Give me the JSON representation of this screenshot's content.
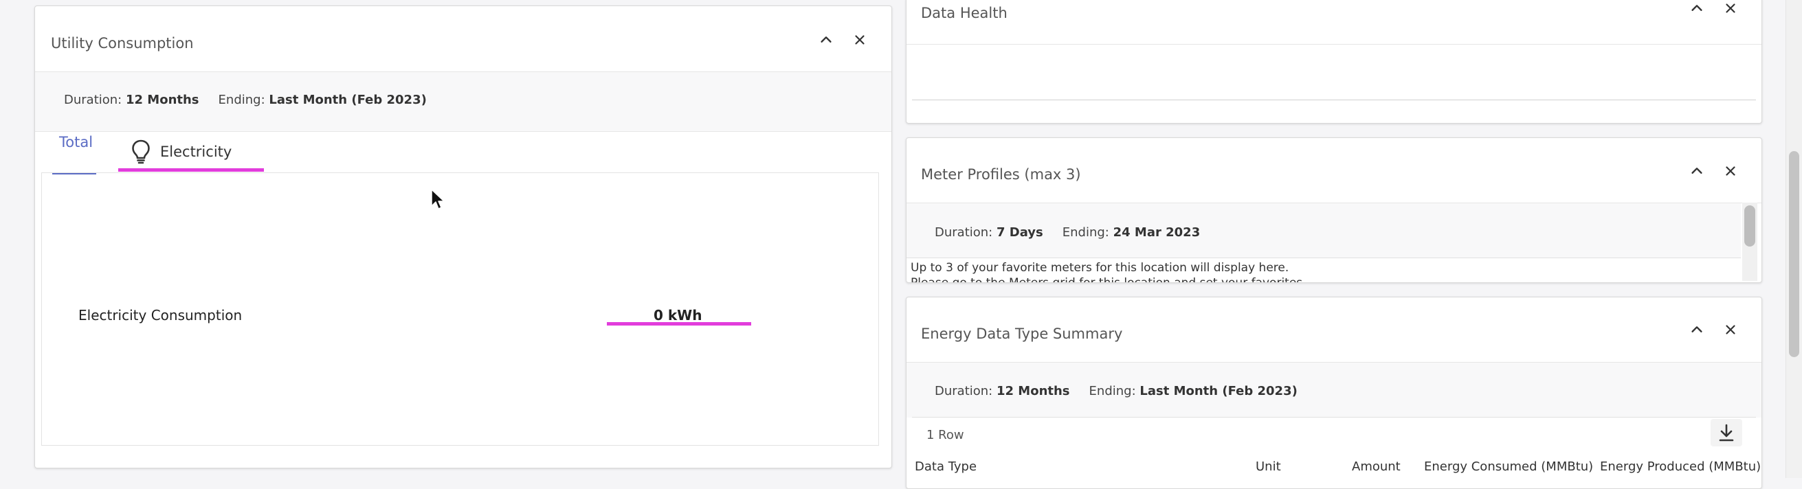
{
  "utility": {
    "title": "Utility Consumption",
    "duration_label": "Duration:",
    "duration_value": "12 Months",
    "ending_label": "Ending:",
    "ending_value": "Last Month (Feb 2023)",
    "tabs": [
      "Total",
      "Electricity"
    ],
    "row_label": "Electricity Consumption",
    "row_value": "0 kWh"
  },
  "data_health": {
    "title": "Data Health"
  },
  "meter_profiles": {
    "title": "Meter Profiles (max 3)",
    "duration_label": "Duration:",
    "duration_value": "7 Days",
    "ending_label": "Ending:",
    "ending_value": "24 Mar 2023",
    "message_line1": "Up to 3 of your favorite meters for this location will display here.",
    "message_line2": "Please go to the Meters grid for this location and set your favorites."
  },
  "energy_summary": {
    "title": "Energy Data Type Summary",
    "duration_label": "Duration:",
    "duration_value": "12 Months",
    "ending_label": "Ending:",
    "ending_value": "Last Month (Feb 2023)",
    "row_count": "1 Row",
    "columns": [
      "Data Type",
      "Unit",
      "Amount",
      "Energy Consumed (MMBtu)",
      "Energy Produced (MMBtu)"
    ]
  },
  "colors": {
    "accent_blue": "#5b6cc4",
    "highlight_pink": "#e23ddc",
    "title_gray": "#555555"
  },
  "icons": [
    "chevron-up-icon",
    "close-icon",
    "lightbulb-icon",
    "download-icon",
    "mouse-cursor-icon"
  ]
}
